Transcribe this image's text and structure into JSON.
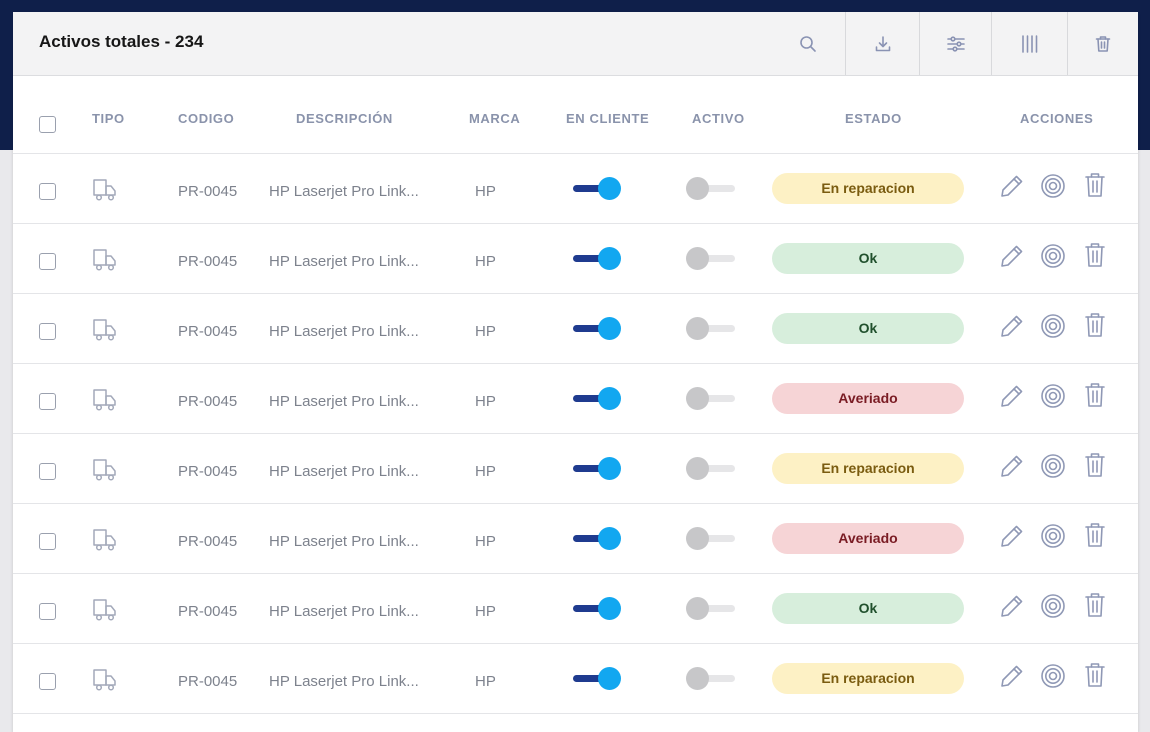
{
  "header": {
    "title": "Activos totales - 234"
  },
  "toolbar": {
    "icons": [
      "search-icon",
      "download-icon",
      "filter-sliders-icon",
      "columns-icon",
      "trash-icon"
    ]
  },
  "table": {
    "columns": [
      "TIPO",
      "CODIGO",
      "DESCRIPCIÓN",
      "MARCA",
      "EN CLIENTE",
      "ACTIVO",
      "ESTADO",
      "ACCIONES"
    ],
    "rows": [
      {
        "code": "PR-0045",
        "description": "HP Laserjet Pro Link...",
        "brand": "HP",
        "en_cliente": true,
        "activo": false,
        "estado": "En reparacion",
        "estado_kind": "rep"
      },
      {
        "code": "PR-0045",
        "description": "HP Laserjet Pro Link...",
        "brand": "HP",
        "en_cliente": true,
        "activo": false,
        "estado": "Ok",
        "estado_kind": "ok"
      },
      {
        "code": "PR-0045",
        "description": "HP Laserjet Pro Link...",
        "brand": "HP",
        "en_cliente": true,
        "activo": false,
        "estado": "Ok",
        "estado_kind": "ok"
      },
      {
        "code": "PR-0045",
        "description": "HP Laserjet Pro Link...",
        "brand": "HP",
        "en_cliente": true,
        "activo": false,
        "estado": "Averiado",
        "estado_kind": "ave"
      },
      {
        "code": "PR-0045",
        "description": "HP Laserjet Pro Link...",
        "brand": "HP",
        "en_cliente": true,
        "activo": false,
        "estado": "En reparacion",
        "estado_kind": "rep"
      },
      {
        "code": "PR-0045",
        "description": "HP Laserjet Pro Link...",
        "brand": "HP",
        "en_cliente": true,
        "activo": false,
        "estado": "Averiado",
        "estado_kind": "ave"
      },
      {
        "code": "PR-0045",
        "description": "HP Laserjet Pro Link...",
        "brand": "HP",
        "en_cliente": true,
        "activo": false,
        "estado": "Ok",
        "estado_kind": "ok"
      },
      {
        "code": "PR-0045",
        "description": "HP Laserjet Pro Link...",
        "brand": "HP",
        "en_cliente": true,
        "activo": false,
        "estado": "En reparacion",
        "estado_kind": "rep"
      }
    ]
  },
  "colors": {
    "header_bg": "#0f1f4a",
    "toggle_on": "#12a7f0",
    "toggle_track_on": "#1f3b8f",
    "badge_repair": "#fdf1c5",
    "badge_ok": "#d7eedc",
    "badge_broken": "#f6d4d6"
  }
}
